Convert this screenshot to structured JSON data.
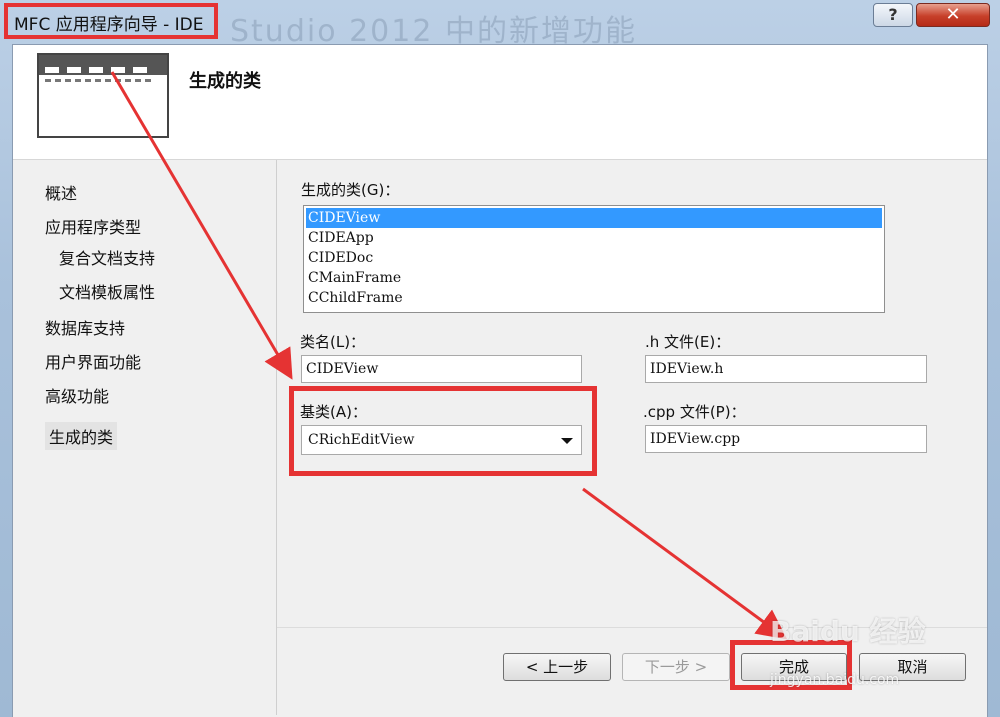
{
  "window": {
    "title": "MFC 应用程序向导 - IDE",
    "background_ghost_text": "Studio 2012 中的新增功能",
    "help_label": "?",
    "close_label": "✕"
  },
  "banner": {
    "title": "生成的类",
    "icon": "wizard-window-icon"
  },
  "nav": {
    "items": [
      {
        "label": "概述"
      },
      {
        "label": "应用程序类型"
      },
      {
        "label": "复合文档支持"
      },
      {
        "label": "文档模板属性"
      },
      {
        "label": "数据库支持"
      },
      {
        "label": "用户界面功能"
      },
      {
        "label": "高级功能"
      },
      {
        "label": "生成的类"
      }
    ],
    "active_index": 7
  },
  "form": {
    "classes_label": "生成的类(G)：",
    "classes": [
      "CIDEView",
      "CIDEApp",
      "CIDEDoc",
      "CMainFrame",
      "CChildFrame"
    ],
    "selected_class": "CIDEView",
    "class_name_label": "类名(L)：",
    "class_name_value": "CIDEView",
    "h_file_label": ".h 文件(E)：",
    "h_file_value": "IDEView.h",
    "base_class_label": "基类(A)：",
    "base_class_value": "CRichEditView",
    "cpp_file_label": ".cpp 文件(P)：",
    "cpp_file_value": "IDEView.cpp"
  },
  "buttons": {
    "back": "< 上一步",
    "next": "下一步 >",
    "finish": "完成",
    "cancel": "取消"
  },
  "watermark": {
    "main": "Baidu 经验",
    "sub": "jingyan.baidu.com"
  },
  "colors": {
    "highlight": "#e53333",
    "selection": "#3399ff"
  }
}
